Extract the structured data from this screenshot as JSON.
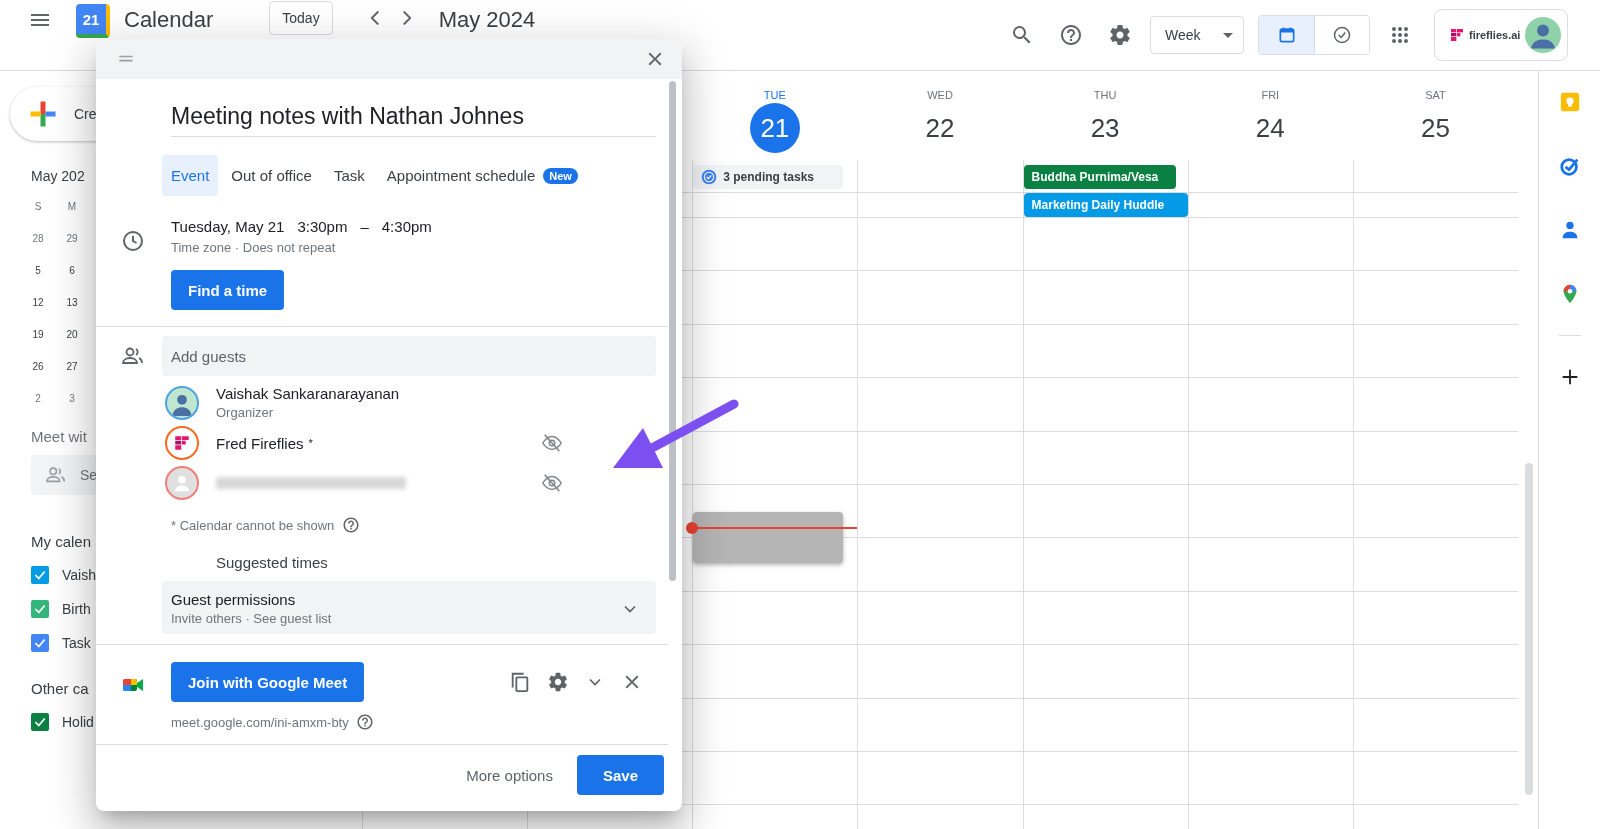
{
  "top_bar": {
    "logo_day": "21",
    "app_name": "Calendar",
    "today_button": "Today",
    "date_range": "May 2024",
    "view_select": "Week",
    "view_toggle": [
      {
        "kind": "calendar",
        "selected": true
      },
      {
        "kind": "tasks",
        "selected": false
      }
    ],
    "account_brand": "fireflies.ai"
  },
  "sidebar": {
    "create_button": "Cre",
    "mini_calendar": {
      "month": "May 202",
      "weekdays": [
        "S",
        "M"
      ],
      "weeks": [
        [
          {
            "day": "28",
            "other_month": true
          },
          {
            "day": "29",
            "other_month": true
          }
        ],
        [
          {
            "day": "5",
            "other_month": false
          },
          {
            "day": "6",
            "other_month": false
          }
        ],
        [
          {
            "day": "12",
            "other_month": false
          },
          {
            "day": "13",
            "other_month": false
          }
        ],
        [
          {
            "day": "19",
            "other_month": false
          },
          {
            "day": "20",
            "other_month": false
          }
        ],
        [
          {
            "day": "26",
            "other_month": false
          },
          {
            "day": "27",
            "other_month": false
          }
        ],
        [
          {
            "day": "2",
            "other_month": true
          },
          {
            "day": "3",
            "other_month": true
          }
        ]
      ]
    },
    "meet_with": "Meet wit",
    "search_people_placeholder": "Se",
    "my_calendars": {
      "title": "My calen",
      "items": [
        {
          "label": "Vaish",
          "color": "#039be5",
          "checked": true
        },
        {
          "label": "Birth",
          "color": "#33b679",
          "checked": true
        },
        {
          "label": "Task",
          "color": "#4285f4",
          "checked": true
        }
      ]
    },
    "other_calendars": {
      "title": "Other ca",
      "items": [
        {
          "label": "Holid",
          "color": "#0b8043",
          "checked": true
        }
      ]
    }
  },
  "week": {
    "days": [
      {
        "weekday": "TUE",
        "date": "21",
        "selected": true,
        "all_day": [
          {
            "kind": "tasks",
            "title": "3 pending tasks"
          }
        ],
        "draft_event": true,
        "now_indicator": true
      },
      {
        "weekday": "WED",
        "date": "22",
        "selected": false
      },
      {
        "weekday": "THU",
        "date": "23",
        "selected": false,
        "all_day": [
          {
            "kind": "event",
            "title": "Buddha Purnima/Vesa",
            "color": "#0b8043"
          }
        ],
        "events": [
          {
            "title": "Marketing Daily Huddle",
            "color": "#039be5"
          }
        ]
      },
      {
        "weekday": "FRI",
        "date": "24",
        "selected": false
      },
      {
        "weekday": "SAT",
        "date": "25",
        "selected": false
      }
    ]
  },
  "dialog": {
    "title": "Meeting notes with Nathan Johnes",
    "tabs": [
      {
        "label": "Event",
        "selected": true
      },
      {
        "label": "Out of office",
        "selected": false
      },
      {
        "label": "Task",
        "selected": false
      },
      {
        "label": "Appointment schedule",
        "selected": false,
        "badge": "New"
      }
    ],
    "when": {
      "date": "Tuesday, May 21",
      "start": "3:30pm",
      "separator": "–",
      "end": "4:30pm",
      "details": "Time zone · Does not repeat"
    },
    "find_time_button": "Find a time",
    "guests_placeholder": "Add guests",
    "guests": [
      {
        "kind": "photo",
        "name": "Vaishak Sankaranarayanan",
        "role": "Organizer"
      },
      {
        "kind": "logo",
        "name": "Fred Fireflies",
        "marker": "*",
        "calendar_hidden": true
      },
      {
        "kind": "default",
        "redacted": true,
        "calendar_hidden": true
      }
    ],
    "calendar_note": "* Calendar cannot be shown",
    "suggested_times": "Suggested times",
    "guest_permissions": {
      "title": "Guest permissions",
      "summary": "Invite others · See guest list",
      "expanded": false
    },
    "meet": {
      "join_button": "Join with Google Meet",
      "link": "meet.google.com/ini-amxm-bty"
    },
    "more_options": "More options",
    "save_button": "Save"
  }
}
